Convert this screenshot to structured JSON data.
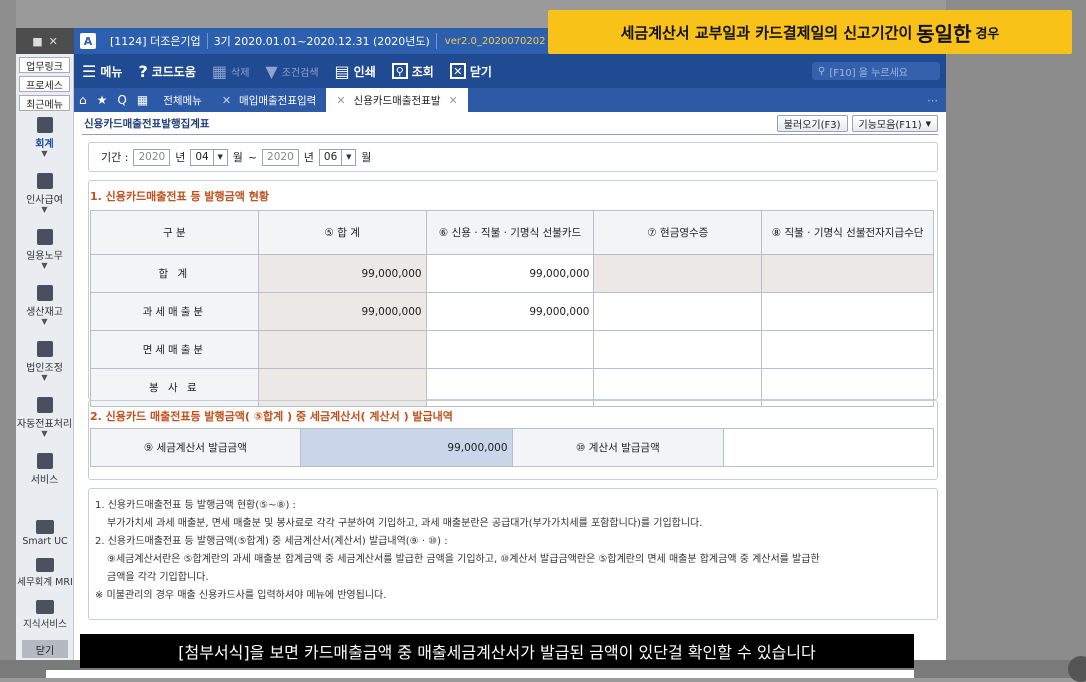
{
  "headline": {
    "prefix": "세금계산서 교부일과 카드결제일의 신고기간이",
    "emphasis": "동일한",
    "suffix": "경우"
  },
  "titlebar": {
    "logo": "A",
    "company": "[1124] 더조은기업",
    "fiscal": "3기 2020.01.01~2020.12.31 (2020년도)",
    "version": "ver2.0_2020070202"
  },
  "sidebar": {
    "top_buttons": [
      "업무링크",
      "프로세스",
      "최근메뉴"
    ],
    "modules": [
      "회계",
      "인사급여",
      "일용노무",
      "생산재고",
      "법인조정",
      "자동전표처리",
      "서비스"
    ],
    "bottom_modules": [
      "Smart UC",
      "세무회계 MRI",
      "지식서비스"
    ],
    "close_label": "닫기"
  },
  "toolbar": {
    "menu": "메뉴",
    "help": "코드도움",
    "delete": "삭제",
    "filter": "조건검색",
    "print": "인쇄",
    "view": "조회",
    "close": "닫기",
    "search_placeholder": "[F10] 을 누르세요"
  },
  "tabs": {
    "all_menu": "전체메뉴",
    "items": [
      "매입매출전표입력",
      "신용카드매출전표발"
    ]
  },
  "form": {
    "title": "신용카드매출전표발행집계표",
    "btn_load": "불러오기(F3)",
    "btn_func": "기능모음(F11)",
    "period": {
      "label": "기간 :",
      "from_year": "2020",
      "from_month": "04",
      "to_year": "2020",
      "to_month": "06",
      "year_unit": "년",
      "month_unit": "월",
      "tilde": "~"
    },
    "section1_title": "1. 신용카드매출전표 등 발행금액 현황",
    "table1": {
      "headers": [
        "구 분",
        "⑤ 합 계",
        "⑥ 신용 · 직불 · 기명식 선불카드",
        "⑦ 현금영수증",
        "⑧ 직불 · 기명식 선불전자지급수단"
      ],
      "rows": [
        {
          "label": "합 계",
          "total": "99,000,000",
          "card": "99,000,000"
        },
        {
          "label": "과세매출분",
          "total": "99,000,000",
          "card": "99,000,000"
        },
        {
          "label": "면세매출분",
          "total": "",
          "card": ""
        },
        {
          "label": "봉 사 료",
          "total": "",
          "card": ""
        }
      ]
    },
    "section2_title": "2. 신용카드 매출전표등 발행금액( ⑤합계 ) 중 세금계산서( 계산서 ) 발급내역",
    "table2": {
      "tax_invoice_label": "⑨ 세금계산서 발급금액",
      "tax_invoice_value": "99,000,000",
      "invoice_label": "⑩ 계산서 발급금액",
      "invoice_value": ""
    },
    "notes": [
      "1. 신용카드매출전표 등 발행금액 현황(⑤~⑧) :",
      "부가가치세 과세 매출분, 면세 매출분 및 봉사료로 각각 구분하여 기입하고, 과세 매출분란은 공급대가(부가가치세를 포함합니다)를 기입합니다.",
      "2. 신용카드매출전표 등 발행금액(⑤합계) 중 세금계산서(계산서) 발급내역(⑨ · ⑩) :",
      "⑨세금계산서란은 ⑤합계란의 과세 매출분 합계금액 중 세금계산서를 발급한 금액을 기입하고, ⑩계산서 발급금액란은 ⑤합계란의 면세 매출분 합계금액 중 계산서를 발급한",
      "금액을 각각 기입합니다.",
      "※ 미불관리의 경우 매출 신용카드사를 입력하셔야 메뉴에 반영됩니다."
    ]
  },
  "subtitle": "[첨부서식]을 보면 카드매출금액 중 매출세금계산서가 발급된 금액이 있단걸 확인할 수 있습니다",
  "colors": {
    "accent": "#204a92",
    "section_title": "#c0501c",
    "headline_bg": "#f8c218"
  }
}
